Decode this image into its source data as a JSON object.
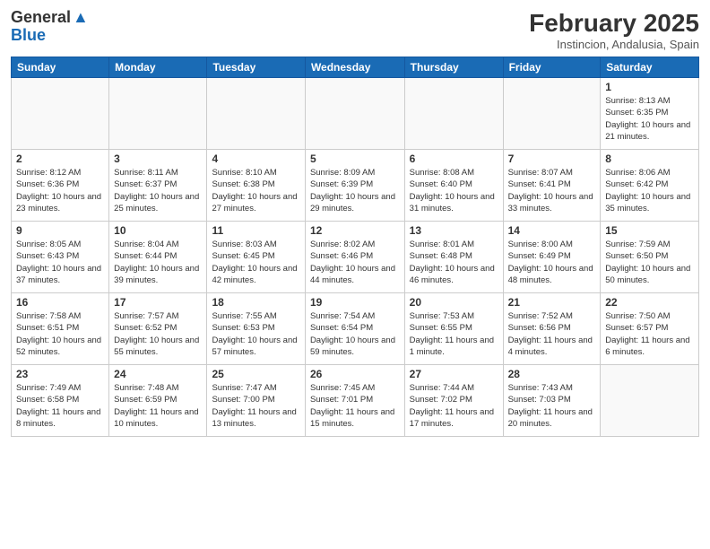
{
  "header": {
    "logo_line1": "General",
    "logo_line2": "Blue",
    "title": "February 2025",
    "subtitle": "Instincion, Andalusia, Spain"
  },
  "days_of_week": [
    "Sunday",
    "Monday",
    "Tuesday",
    "Wednesday",
    "Thursday",
    "Friday",
    "Saturday"
  ],
  "weeks": [
    [
      {
        "day": "",
        "info": ""
      },
      {
        "day": "",
        "info": ""
      },
      {
        "day": "",
        "info": ""
      },
      {
        "day": "",
        "info": ""
      },
      {
        "day": "",
        "info": ""
      },
      {
        "day": "",
        "info": ""
      },
      {
        "day": "1",
        "info": "Sunrise: 8:13 AM\nSunset: 6:35 PM\nDaylight: 10 hours and 21 minutes."
      }
    ],
    [
      {
        "day": "2",
        "info": "Sunrise: 8:12 AM\nSunset: 6:36 PM\nDaylight: 10 hours and 23 minutes."
      },
      {
        "day": "3",
        "info": "Sunrise: 8:11 AM\nSunset: 6:37 PM\nDaylight: 10 hours and 25 minutes."
      },
      {
        "day": "4",
        "info": "Sunrise: 8:10 AM\nSunset: 6:38 PM\nDaylight: 10 hours and 27 minutes."
      },
      {
        "day": "5",
        "info": "Sunrise: 8:09 AM\nSunset: 6:39 PM\nDaylight: 10 hours and 29 minutes."
      },
      {
        "day": "6",
        "info": "Sunrise: 8:08 AM\nSunset: 6:40 PM\nDaylight: 10 hours and 31 minutes."
      },
      {
        "day": "7",
        "info": "Sunrise: 8:07 AM\nSunset: 6:41 PM\nDaylight: 10 hours and 33 minutes."
      },
      {
        "day": "8",
        "info": "Sunrise: 8:06 AM\nSunset: 6:42 PM\nDaylight: 10 hours and 35 minutes."
      }
    ],
    [
      {
        "day": "9",
        "info": "Sunrise: 8:05 AM\nSunset: 6:43 PM\nDaylight: 10 hours and 37 minutes."
      },
      {
        "day": "10",
        "info": "Sunrise: 8:04 AM\nSunset: 6:44 PM\nDaylight: 10 hours and 39 minutes."
      },
      {
        "day": "11",
        "info": "Sunrise: 8:03 AM\nSunset: 6:45 PM\nDaylight: 10 hours and 42 minutes."
      },
      {
        "day": "12",
        "info": "Sunrise: 8:02 AM\nSunset: 6:46 PM\nDaylight: 10 hours and 44 minutes."
      },
      {
        "day": "13",
        "info": "Sunrise: 8:01 AM\nSunset: 6:48 PM\nDaylight: 10 hours and 46 minutes."
      },
      {
        "day": "14",
        "info": "Sunrise: 8:00 AM\nSunset: 6:49 PM\nDaylight: 10 hours and 48 minutes."
      },
      {
        "day": "15",
        "info": "Sunrise: 7:59 AM\nSunset: 6:50 PM\nDaylight: 10 hours and 50 minutes."
      }
    ],
    [
      {
        "day": "16",
        "info": "Sunrise: 7:58 AM\nSunset: 6:51 PM\nDaylight: 10 hours and 52 minutes."
      },
      {
        "day": "17",
        "info": "Sunrise: 7:57 AM\nSunset: 6:52 PM\nDaylight: 10 hours and 55 minutes."
      },
      {
        "day": "18",
        "info": "Sunrise: 7:55 AM\nSunset: 6:53 PM\nDaylight: 10 hours and 57 minutes."
      },
      {
        "day": "19",
        "info": "Sunrise: 7:54 AM\nSunset: 6:54 PM\nDaylight: 10 hours and 59 minutes."
      },
      {
        "day": "20",
        "info": "Sunrise: 7:53 AM\nSunset: 6:55 PM\nDaylight: 11 hours and 1 minute."
      },
      {
        "day": "21",
        "info": "Sunrise: 7:52 AM\nSunset: 6:56 PM\nDaylight: 11 hours and 4 minutes."
      },
      {
        "day": "22",
        "info": "Sunrise: 7:50 AM\nSunset: 6:57 PM\nDaylight: 11 hours and 6 minutes."
      }
    ],
    [
      {
        "day": "23",
        "info": "Sunrise: 7:49 AM\nSunset: 6:58 PM\nDaylight: 11 hours and 8 minutes."
      },
      {
        "day": "24",
        "info": "Sunrise: 7:48 AM\nSunset: 6:59 PM\nDaylight: 11 hours and 10 minutes."
      },
      {
        "day": "25",
        "info": "Sunrise: 7:47 AM\nSunset: 7:00 PM\nDaylight: 11 hours and 13 minutes."
      },
      {
        "day": "26",
        "info": "Sunrise: 7:45 AM\nSunset: 7:01 PM\nDaylight: 11 hours and 15 minutes."
      },
      {
        "day": "27",
        "info": "Sunrise: 7:44 AM\nSunset: 7:02 PM\nDaylight: 11 hours and 17 minutes."
      },
      {
        "day": "28",
        "info": "Sunrise: 7:43 AM\nSunset: 7:03 PM\nDaylight: 11 hours and 20 minutes."
      },
      {
        "day": "",
        "info": ""
      }
    ]
  ]
}
